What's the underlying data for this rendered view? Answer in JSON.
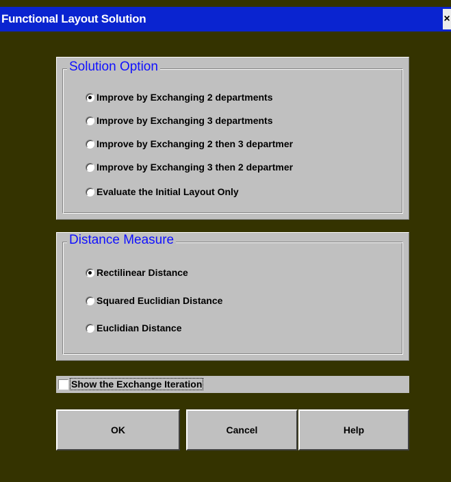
{
  "window": {
    "title": "Functional Layout Solution",
    "close_symbol": "×"
  },
  "solution_option": {
    "legend": "Solution Option",
    "options": [
      {
        "label": "Improve by Exchanging 2 departments",
        "checked": true
      },
      {
        "label": "Improve by Exchanging 3 departments",
        "checked": false
      },
      {
        "label": "Improve by Exchanging 2 then 3 departmer",
        "checked": false
      },
      {
        "label": "Improve by Exchanging 3 then 2 departmer",
        "checked": false
      },
      {
        "label": "Evaluate the Initial Layout Only",
        "checked": false
      }
    ]
  },
  "distance_measure": {
    "legend": "Distance Measure",
    "options": [
      {
        "label": "Rectilinear Distance",
        "checked": true
      },
      {
        "label": "Squared Euclidian Distance",
        "checked": false
      },
      {
        "label": "Euclidian Distance",
        "checked": false
      }
    ]
  },
  "show_iteration": {
    "label": "Show the Exchange Iteration",
    "checked": false
  },
  "buttons": {
    "ok": "OK",
    "cancel": "Cancel",
    "help": "Help"
  },
  "colors": {
    "title_bar": "#0a24d0",
    "window_bg": "#343300",
    "panel_bg": "#c0c0c0",
    "legend_text": "#1010ff"
  },
  "icons": {
    "close": "close-icon",
    "radio": "radio-icon",
    "checkbox": "checkbox-icon"
  }
}
